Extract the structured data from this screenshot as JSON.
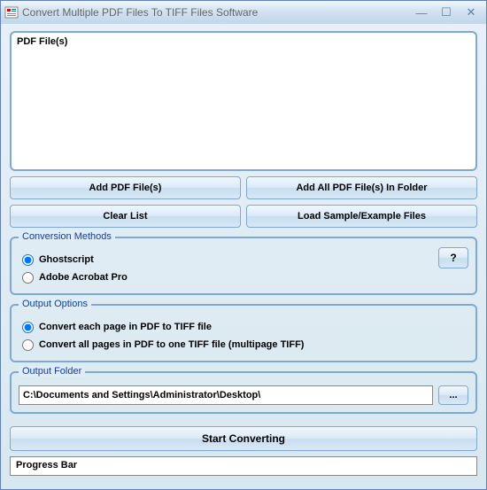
{
  "window": {
    "title": "Convert Multiple PDF Files To TIFF Files Software"
  },
  "filelist": {
    "label": "PDF File(s)"
  },
  "buttons": {
    "add_files": "Add PDF File(s)",
    "add_folder": "Add All PDF File(s) In Folder",
    "clear_list": "Clear List",
    "load_sample": "Load Sample/Example Files",
    "help": "?",
    "browse": "...",
    "start": "Start Converting"
  },
  "groups": {
    "conversion_methods": {
      "title": "Conversion Methods",
      "options": {
        "ghostscript": "Ghostscript",
        "acrobat": "Adobe Acrobat Pro"
      },
      "selected": "ghostscript"
    },
    "output_options": {
      "title": "Output Options",
      "options": {
        "each_page": "Convert each page in PDF to TIFF file",
        "all_pages": "Convert all pages in PDF to one TIFF file (multipage TIFF)"
      },
      "selected": "each_page"
    },
    "output_folder": {
      "title": "Output Folder",
      "path": "C:\\Documents and Settings\\Administrator\\Desktop\\"
    }
  },
  "progress": {
    "label": "Progress Bar"
  },
  "titlebar_controls": {
    "minimize": "—",
    "maximize": "☐",
    "close": "✕"
  }
}
